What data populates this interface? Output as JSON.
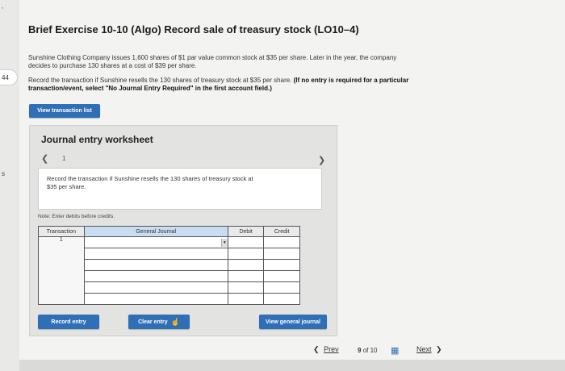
{
  "gutter": {
    "tab_label": "44",
    "mark": "s"
  },
  "exercise": {
    "title": "Brief Exercise 10-10 (Algo) Record sale of treasury stock (LO10–4)",
    "intro_line1": "Sunshine Clothing Company issues 1,600 shares of $1 par value common stock at $35 per share. Later in the year, the company",
    "intro_line2": "decides to purchase 130 shares at a cost of $39 per share.",
    "task_line1_plain": "Record the transaction if Sunshine resells the 130 shares of treasury stock at $35 per share. ",
    "task_line1_bold": "(If no entry is required for a particular",
    "task_line2_bold": "transaction/event, select \"No Journal Entry Required\" in the first account field.)"
  },
  "buttons": {
    "view_transaction_list": "View transaction list",
    "record_entry": "Record entry",
    "clear_entry": "Clear entry",
    "view_general_journal": "View general journal"
  },
  "worksheet": {
    "title": "Journal entry worksheet",
    "page_number": "1",
    "instruction_line1": "Record the transaction if Sunshine resells the 130 shares of treasury stock at",
    "instruction_line2": "$35 per share.",
    "note": "Note: Enter debits before credits.",
    "columns": [
      "Transaction",
      "General Journal",
      "Debit",
      "Credit"
    ],
    "transaction_number": "1"
  },
  "footer": {
    "prev": "Prev",
    "page_current": "9",
    "page_of": "of",
    "page_total": "10",
    "next": "Next"
  },
  "colors": {
    "accent": "#2f6fb5",
    "selected_header": "#c9dcf2"
  }
}
